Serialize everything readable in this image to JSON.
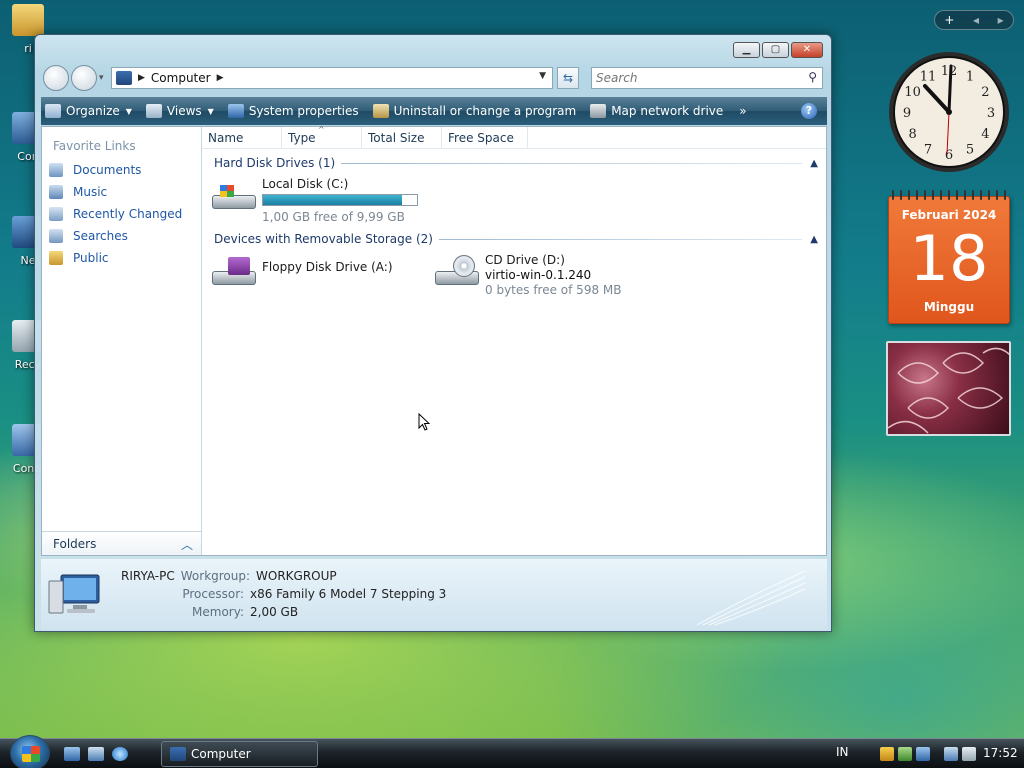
{
  "desktop": {
    "icons": [
      {
        "label": "ri"
      },
      {
        "label": "Con"
      },
      {
        "label": "Ne"
      },
      {
        "label": "Recy"
      },
      {
        "label": "Contr"
      }
    ]
  },
  "window": {
    "address": {
      "crumb": "Computer"
    },
    "search": {
      "placeholder": "Search"
    },
    "toolbar": {
      "organize": "Organize",
      "views": "Views",
      "system_properties": "System properties",
      "uninstall": "Uninstall or change a program",
      "map_drive": "Map network drive",
      "more": "»"
    },
    "favorites": {
      "title": "Favorite Links",
      "items": [
        {
          "label": "Documents"
        },
        {
          "label": "Music"
        },
        {
          "label": "Recently Changed"
        },
        {
          "label": "Searches"
        },
        {
          "label": "Public"
        }
      ]
    },
    "folders_label": "Folders",
    "columns": [
      "Name",
      "Type",
      "Total Size",
      "Free Space"
    ],
    "groups": [
      {
        "title": "Hard Disk Drives (1)",
        "drives": [
          {
            "name": "Local Disk (C:)",
            "used_fraction": 0.9,
            "free_text": "1,00 GB free of 9,99 GB"
          }
        ]
      },
      {
        "title": "Devices with Removable Storage (2)",
        "drives": [
          {
            "name": "Floppy Disk Drive (A:)"
          },
          {
            "name": "CD Drive (D:)",
            "label": "virtio-win-0.1.240",
            "free_text": "0 bytes free of 598 MB"
          }
        ]
      }
    ],
    "details": {
      "pc_name": "RIRYA-PC",
      "workgroup_label": "Workgroup:",
      "workgroup": "WORKGROUP",
      "processor_label": "Processor:",
      "processor": "x86 Family 6 Model 7 Stepping 3",
      "memory_label": "Memory:",
      "memory": "2,00 GB"
    }
  },
  "sidebar": {
    "controls": {
      "add": "+",
      "prev": "◂",
      "next": "▸"
    },
    "calendar": {
      "month": "Februari 2024",
      "day": "18",
      "weekday": "Minggu"
    },
    "clock": {
      "numbers": [
        "12",
        "1",
        "2",
        "3",
        "4",
        "5",
        "6",
        "7",
        "8",
        "9",
        "10",
        "11"
      ]
    }
  },
  "taskbar": {
    "task": "Computer",
    "lang": "IN",
    "time": "17:52"
  },
  "colors": {
    "accent": "#2c6aa5",
    "toolbar": "#2f5c76",
    "calendar": "#e0561c"
  }
}
